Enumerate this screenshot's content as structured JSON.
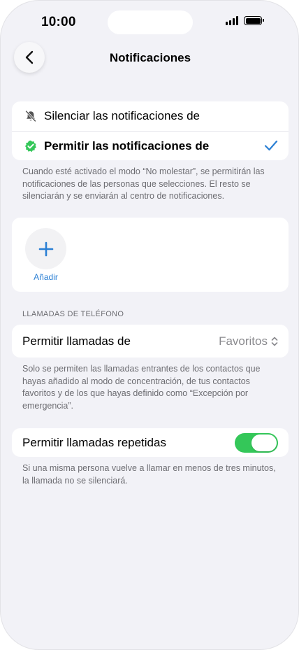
{
  "status_bar": {
    "time": "10:00"
  },
  "nav": {
    "title": "Notificaciones",
    "back_icon": "chevron-left-icon"
  },
  "mode": {
    "items": [
      {
        "label": "Silenciar las notificaciones de",
        "icon": "bell-slash-icon",
        "selected": false
      },
      {
        "label": "Permitir las notificaciones de",
        "icon": "green-check-badge-icon",
        "selected": true
      }
    ],
    "footnote": "Cuando esté activado el modo “No molestar”, se permitirán las notificaciones de las personas que selecciones. El resto se silenciarán y se enviarán al centro de notificaciones."
  },
  "add": {
    "label": "Añadir",
    "icon": "plus-icon"
  },
  "calls": {
    "header": "LLAMADAS DE TELÉFONO",
    "allow_label": "Permitir llamadas de",
    "allow_value": "Favoritos",
    "footnote": "Solo se permiten las llamadas entrantes de los contactos que hayas añadido al modo de concentración, de tus contactos favoritos y de los que hayas definido como “Excepción por emergencia”.",
    "repeat_label": "Permitir llamadas repetidas",
    "repeat_enabled": true,
    "repeat_footnote": "Si una misma persona vuelve a llamar en menos de tres minutos, la llamada no se silenciará."
  },
  "colors": {
    "accent": "#2a7fd4",
    "toggle_on": "#34c759",
    "badge_green": "#34c759",
    "background": "#f2f2f7"
  }
}
